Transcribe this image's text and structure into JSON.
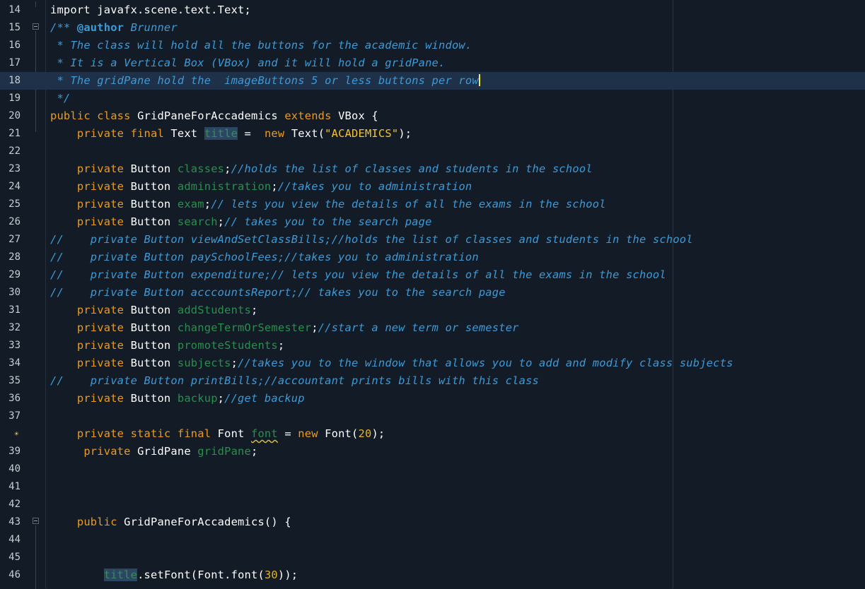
{
  "editor": {
    "lines": [
      {
        "n": "14",
        "parts": [
          {
            "t": "import javafx.scene.text.Text;",
            "c": ""
          }
        ]
      },
      {
        "n": "15",
        "parts": [
          {
            "t": "/** ",
            "c": "cm"
          },
          {
            "t": "@author",
            "c": "tag"
          },
          {
            "t": " Brunner",
            "c": "cm"
          }
        ]
      },
      {
        "n": "16",
        "parts": [
          {
            "t": " * The class will hold all the buttons for the academic window.",
            "c": "cm"
          }
        ]
      },
      {
        "n": "17",
        "parts": [
          {
            "t": " * It is a Vertical Box (VBox) and it will hold a gridPane.",
            "c": "cm"
          }
        ]
      },
      {
        "n": "18",
        "parts": [
          {
            "t": " * The gridPane hold the  imageButtons 5 or less buttons per row",
            "c": "cm"
          }
        ],
        "highlight": true
      },
      {
        "n": "19",
        "parts": [
          {
            "t": " */",
            "c": "cm"
          }
        ]
      },
      {
        "n": "20",
        "parts": [
          {
            "t": "public class ",
            "c": "kw"
          },
          {
            "t": "GridPaneForAccademics ",
            "c": ""
          },
          {
            "t": "extends ",
            "c": "kw"
          },
          {
            "t": "VBox {",
            "c": ""
          }
        ]
      },
      {
        "n": "21",
        "parts": [
          {
            "t": "    private final ",
            "c": "kw"
          },
          {
            "t": "Text ",
            "c": ""
          },
          {
            "t": "title",
            "c": "sel"
          },
          {
            "t": " =  ",
            "c": ""
          },
          {
            "t": "new ",
            "c": "kw"
          },
          {
            "t": "Text(",
            "c": ""
          },
          {
            "t": "\"ACADEMICS\"",
            "c": "str"
          },
          {
            "t": ");",
            "c": ""
          }
        ]
      },
      {
        "n": "22",
        "parts": []
      },
      {
        "n": "23",
        "parts": [
          {
            "t": "    private ",
            "c": "kw"
          },
          {
            "t": "Button ",
            "c": ""
          },
          {
            "t": "classes",
            "c": "field"
          },
          {
            "t": ";",
            "c": ""
          },
          {
            "t": "//holds the list of classes and students in the school",
            "c": "cm"
          }
        ]
      },
      {
        "n": "24",
        "parts": [
          {
            "t": "    private ",
            "c": "kw"
          },
          {
            "t": "Button ",
            "c": ""
          },
          {
            "t": "administration",
            "c": "field"
          },
          {
            "t": ";",
            "c": ""
          },
          {
            "t": "//takes you to administration",
            "c": "cm"
          }
        ]
      },
      {
        "n": "25",
        "parts": [
          {
            "t": "    private ",
            "c": "kw"
          },
          {
            "t": "Button ",
            "c": ""
          },
          {
            "t": "exam",
            "c": "field"
          },
          {
            "t": ";",
            "c": ""
          },
          {
            "t": "// lets you view the details of all the exams in the school",
            "c": "cm"
          }
        ]
      },
      {
        "n": "26",
        "parts": [
          {
            "t": "    private ",
            "c": "kw"
          },
          {
            "t": "Button ",
            "c": ""
          },
          {
            "t": "search",
            "c": "field"
          },
          {
            "t": ";",
            "c": ""
          },
          {
            "t": "// takes you to the search page",
            "c": "cm"
          }
        ]
      },
      {
        "n": "27",
        "parts": [
          {
            "t": "//    private Button viewAndSetClassBills;//holds the list of classes and students in the school",
            "c": "cm"
          }
        ]
      },
      {
        "n": "28",
        "parts": [
          {
            "t": "//    private Button paySchoolFees;//takes you to administration",
            "c": "cm"
          }
        ]
      },
      {
        "n": "29",
        "parts": [
          {
            "t": "//    private Button expenditure;// lets you view the details of all the exams in the school",
            "c": "cm"
          }
        ]
      },
      {
        "n": "30",
        "parts": [
          {
            "t": "//    private Button acccountsReport;// takes you to the search page",
            "c": "cm"
          }
        ]
      },
      {
        "n": "31",
        "parts": [
          {
            "t": "    private ",
            "c": "kw"
          },
          {
            "t": "Button ",
            "c": ""
          },
          {
            "t": "addStudents",
            "c": "field"
          },
          {
            "t": ";",
            "c": ""
          }
        ]
      },
      {
        "n": "32",
        "parts": [
          {
            "t": "    private ",
            "c": "kw"
          },
          {
            "t": "Button ",
            "c": ""
          },
          {
            "t": "changeTermOrSemester",
            "c": "field"
          },
          {
            "t": ";",
            "c": ""
          },
          {
            "t": "//start a new term or semester",
            "c": "cm"
          }
        ]
      },
      {
        "n": "33",
        "parts": [
          {
            "t": "    private ",
            "c": "kw"
          },
          {
            "t": "Button ",
            "c": ""
          },
          {
            "t": "promoteStudents",
            "c": "field"
          },
          {
            "t": ";",
            "c": ""
          }
        ]
      },
      {
        "n": "34",
        "parts": [
          {
            "t": "    private ",
            "c": "kw"
          },
          {
            "t": "Button ",
            "c": ""
          },
          {
            "t": "subjects",
            "c": "field"
          },
          {
            "t": ";",
            "c": ""
          },
          {
            "t": "//takes you to the window that allows you to add and modify class subjects",
            "c": "cm"
          }
        ]
      },
      {
        "n": "35",
        "parts": [
          {
            "t": "//    private Button printBills;//accountant prints bills with this class",
            "c": "cm"
          }
        ]
      },
      {
        "n": "36",
        "parts": [
          {
            "t": "    private ",
            "c": "kw"
          },
          {
            "t": "Button ",
            "c": ""
          },
          {
            "t": "backup",
            "c": "field"
          },
          {
            "t": ";",
            "c": ""
          },
          {
            "t": "//get backup",
            "c": "cm"
          }
        ]
      },
      {
        "n": "37",
        "parts": []
      },
      {
        "n": "",
        "parts": [
          {
            "t": "    private static final ",
            "c": "kw"
          },
          {
            "t": "Font ",
            "c": ""
          },
          {
            "t": "font",
            "c": "field squig"
          },
          {
            "t": " = ",
            "c": ""
          },
          {
            "t": "new ",
            "c": "kw"
          },
          {
            "t": "Font(",
            "c": ""
          },
          {
            "t": "20",
            "c": "num"
          },
          {
            "t": ");",
            "c": ""
          }
        ],
        "bulb": true
      },
      {
        "n": "39",
        "parts": [
          {
            "t": "     private ",
            "c": "kw"
          },
          {
            "t": "GridPane ",
            "c": ""
          },
          {
            "t": "gridPane",
            "c": "field"
          },
          {
            "t": ";",
            "c": ""
          }
        ]
      },
      {
        "n": "40",
        "parts": []
      },
      {
        "n": "41",
        "parts": []
      },
      {
        "n": "42",
        "parts": []
      },
      {
        "n": "43",
        "parts": [
          {
            "t": "    public ",
            "c": "kw"
          },
          {
            "t": "GridPaneForAccademics() {",
            "c": ""
          }
        ]
      },
      {
        "n": "44",
        "parts": []
      },
      {
        "n": "45",
        "parts": []
      },
      {
        "n": "46",
        "parts": [
          {
            "t": "        ",
            "c": ""
          },
          {
            "t": "title",
            "c": "sel"
          },
          {
            "t": ".setFont(Font.font(",
            "c": ""
          },
          {
            "t": "30",
            "c": "num"
          },
          {
            "t": "));",
            "c": ""
          }
        ]
      }
    ]
  }
}
